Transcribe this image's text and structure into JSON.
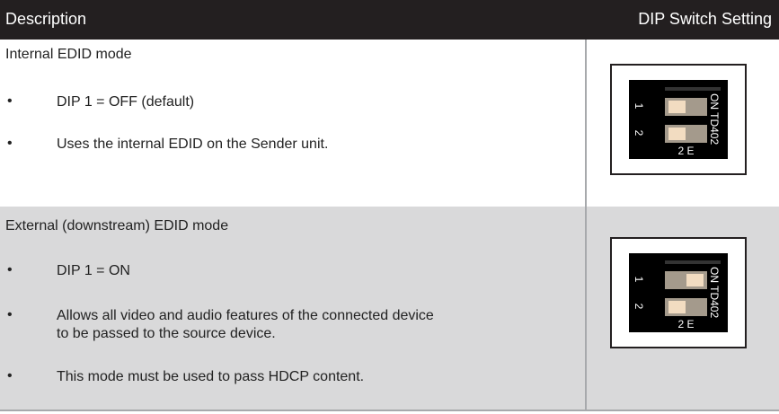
{
  "header": {
    "description": "Description",
    "setting": "DIP Switch Setting"
  },
  "rows": [
    {
      "mode": "Internal EDID mode",
      "bullets": [
        "DIP 1 = OFF (default)",
        "Uses the internal EDID on the Sender unit."
      ],
      "dip": {
        "numbers": [
          "1",
          "2"
        ],
        "label": "2 E",
        "brand": "ON TD402",
        "switch1": "OFF",
        "switch2": "OFF"
      }
    },
    {
      "mode": "External (downstream) EDID mode",
      "bullets": [
        "DIP 1 = ON",
        "Allows all video and audio features of the connected device",
        "to be passed to the source device.",
        "This mode must be used to pass HDCP content."
      ],
      "dip": {
        "numbers": [
          "1",
          "2"
        ],
        "label": "2 E",
        "brand": "ON TD402",
        "switch1": "ON",
        "switch2": "OFF"
      }
    }
  ],
  "bullet_char": "•",
  "colors": {
    "header_bg": "#231f20",
    "row2_bg": "#d9d9da",
    "lever": "#a49a8c",
    "knob": "#f2dcc1"
  }
}
